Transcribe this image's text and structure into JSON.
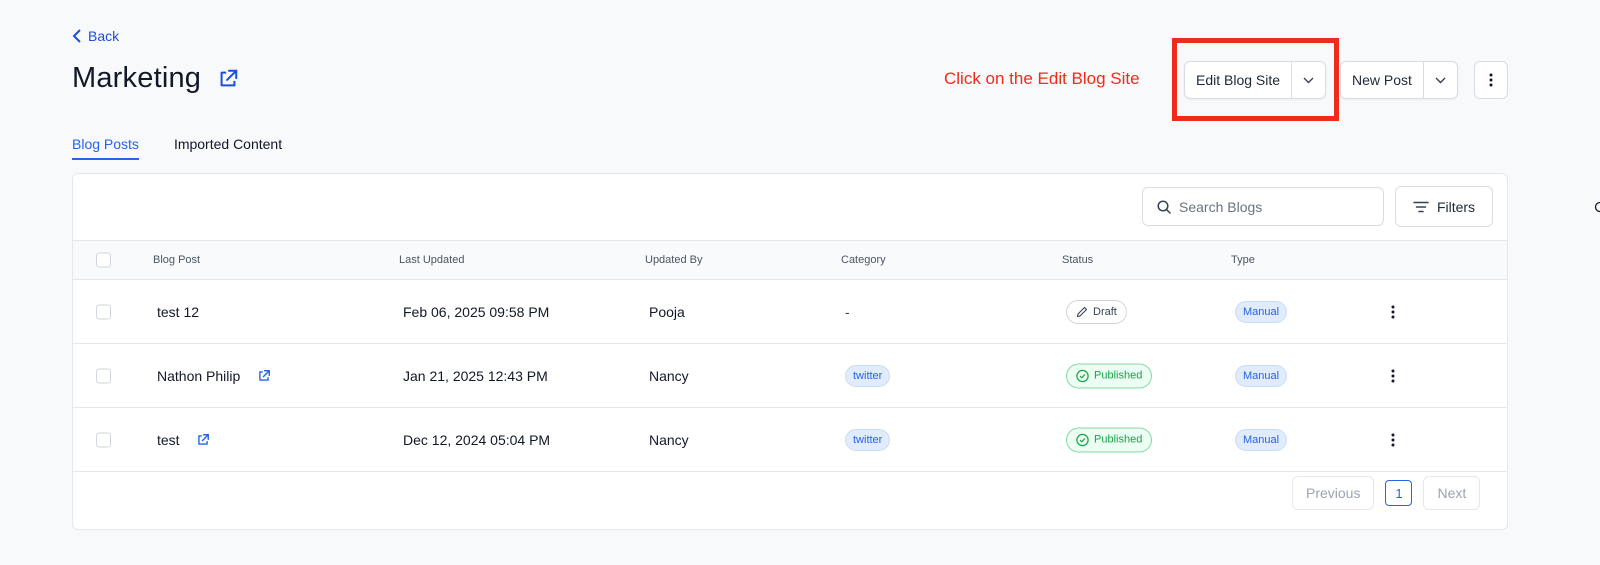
{
  "header": {
    "back_label": "Back",
    "title": "Marketing",
    "annotation": "Click on the Edit Blog Site",
    "edit_blog_site_label": "Edit Blog Site",
    "new_post_label": "New Post"
  },
  "tabs": [
    {
      "label": "Blog Posts",
      "active": true
    },
    {
      "label": "Imported Content",
      "active": false
    }
  ],
  "toolbar": {
    "search_placeholder": "Search Blogs",
    "filters_label": "Filters"
  },
  "table": {
    "columns": [
      "Blog Post",
      "Last Updated",
      "Updated By",
      "Category",
      "Status",
      "Type"
    ],
    "rows": [
      {
        "post": "test 12",
        "has_link": false,
        "updated": "Feb 06, 2025 09:58 PM",
        "by": "Pooja",
        "category": "-",
        "status": "Draft",
        "type": "Manual"
      },
      {
        "post": "Nathon Philip",
        "has_link": true,
        "updated": "Jan 21, 2025 12:43 PM",
        "by": "Nancy",
        "category": "twitter",
        "status": "Published",
        "type": "Manual"
      },
      {
        "post": "test",
        "has_link": true,
        "updated": "Dec 12, 2024 05:04 PM",
        "by": "Nancy",
        "category": "twitter",
        "status": "Published",
        "type": "Manual"
      }
    ]
  },
  "pagination": {
    "previous_label": "Previous",
    "page": "1",
    "next_label": "Next"
  },
  "colors": {
    "accent": "#2563eb",
    "annotation": "#ef2b1a",
    "published": "#16a34a"
  }
}
